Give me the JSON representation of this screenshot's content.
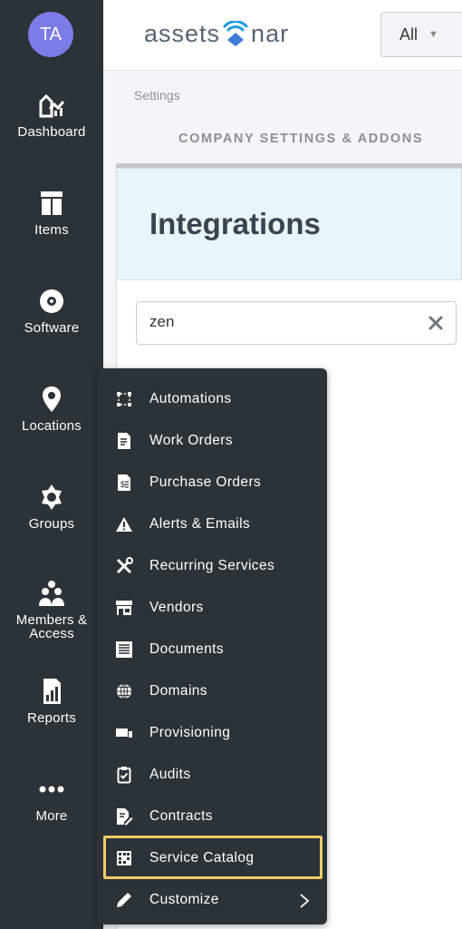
{
  "user": {
    "initials": "TA",
    "avatar_color": "#7c7ce8"
  },
  "sidebar": {
    "items": [
      {
        "label": "Dashboard",
        "icon": "dashboard-icon"
      },
      {
        "label": "Items",
        "icon": "items-icon"
      },
      {
        "label": "Software",
        "icon": "software-icon"
      },
      {
        "label": "Locations",
        "icon": "location-pin-icon"
      },
      {
        "label": "Groups",
        "icon": "groups-icon"
      },
      {
        "label": "Members &\nAccess",
        "icon": "members-icon"
      },
      {
        "label": "Reports",
        "icon": "reports-icon"
      },
      {
        "label": "More",
        "icon": "more-icon"
      }
    ]
  },
  "header": {
    "logo": {
      "left": "assets",
      "right": "nar"
    },
    "scope_select": {
      "value": "All"
    }
  },
  "breadcrumb": {
    "label": "Settings"
  },
  "subnav": {
    "label": "COMPANY SETTINGS & ADDONS"
  },
  "page": {
    "title": "Integrations"
  },
  "search": {
    "value": "zen",
    "placeholder": ""
  },
  "more_menu": {
    "items": [
      {
        "label": "Automations",
        "icon": "automations-icon"
      },
      {
        "label": "Work Orders",
        "icon": "work-orders-icon"
      },
      {
        "label": "Purchase Orders",
        "icon": "purchase-orders-icon"
      },
      {
        "label": "Alerts & Emails",
        "icon": "alert-icon"
      },
      {
        "label": "Recurring Services",
        "icon": "tools-icon"
      },
      {
        "label": "Vendors",
        "icon": "storefront-icon"
      },
      {
        "label": "Documents",
        "icon": "documents-icon"
      },
      {
        "label": "Domains",
        "icon": "globe-icon"
      },
      {
        "label": "Provisioning",
        "icon": "provisioning-icon"
      },
      {
        "label": "Audits",
        "icon": "clipboard-check-icon"
      },
      {
        "label": "Contracts",
        "icon": "contract-icon"
      },
      {
        "label": "Service Catalog",
        "icon": "service-catalog-icon",
        "highlighted": true
      },
      {
        "label": "Customize",
        "icon": "pencil-icon",
        "has_submenu": true
      }
    ]
  },
  "colors": {
    "sidebar": "#2b3238",
    "highlight": "#f4cc67",
    "panel": "#e8f6fb"
  }
}
